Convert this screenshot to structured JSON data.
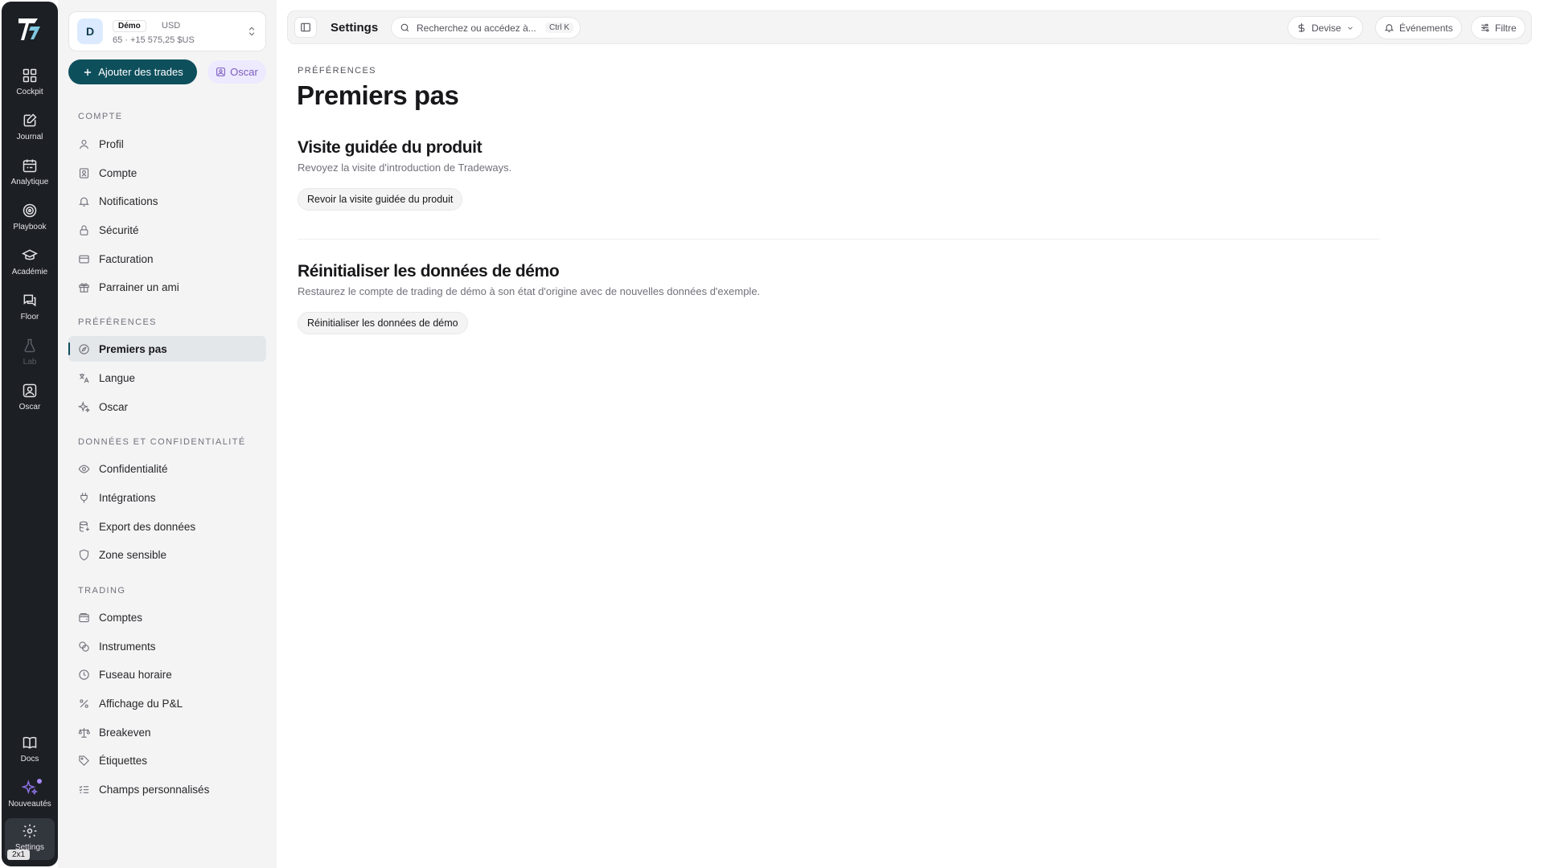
{
  "rail": {
    "items": [
      {
        "label": "Cockpit",
        "icon": "grid-icon"
      },
      {
        "label": "Journal",
        "icon": "edit-note-icon"
      },
      {
        "label": "Analytique",
        "icon": "calendar-chart-icon"
      },
      {
        "label": "Playbook",
        "icon": "target-icon"
      },
      {
        "label": "Académie",
        "icon": "graduation-cap-icon"
      },
      {
        "label": "Floor",
        "icon": "chat-bubbles-icon"
      },
      {
        "label": "Lab",
        "icon": "flask-icon"
      },
      {
        "label": "Oscar",
        "icon": "assistant-portrait-icon"
      }
    ],
    "bottom": [
      {
        "label": "Docs",
        "icon": "book-icon"
      },
      {
        "label": "Nouveautés",
        "icon": "sparkles-icon"
      },
      {
        "label": "Settings",
        "icon": "gear-icon"
      }
    ],
    "zoom": "2x1"
  },
  "account": {
    "avatar": "D",
    "tag": "Démo",
    "currency": "USD",
    "balance": "65 · +15 575,25 $US"
  },
  "actions": {
    "add_trades": "Ajouter des trades",
    "oscar": "Oscar"
  },
  "sidebar": {
    "sections": [
      {
        "title": "COMPTE",
        "items": [
          "Profil",
          "Compte",
          "Notifications",
          "Sécurité",
          "Facturation",
          "Parrainer un ami"
        ]
      },
      {
        "title": "PRÉFÉRENCES",
        "items": [
          "Premiers pas",
          "Langue",
          "Oscar"
        ]
      },
      {
        "title": "DONNÉES ET CONFIDENTIALITÉ",
        "items": [
          "Confidentialité",
          "Intégrations",
          "Export des données",
          "Zone sensible"
        ]
      },
      {
        "title": "TRADING",
        "items": [
          "Comptes",
          "Instruments",
          "Fuseau horaire",
          "Affichage du P&L",
          "Breakeven",
          "Étiquettes",
          "Champs personnalisés"
        ]
      }
    ],
    "active": "Premiers pas"
  },
  "topbar": {
    "title": "Settings",
    "search_placeholder": "Recherchez ou accédez à...",
    "shortcut": "Ctrl K",
    "currency": "Devise",
    "events": "Événements",
    "filter": "Filtre"
  },
  "main": {
    "breadcrumb": "PRÉFÉRENCES",
    "title": "Premiers pas",
    "tour": {
      "heading": "Visite guidée du produit",
      "description": "Revoyez la visite d'introduction de Tradeways.",
      "button": "Revoir la visite guidée du produit"
    },
    "reset": {
      "heading": "Réinitialiser les données de démo",
      "description": "Restaurez le compte de trading de démo à son état d'origine avec de nouvelles données d'exemple.",
      "button": "Réinitialiser les données de démo"
    }
  },
  "colors": {
    "rail_bg": "#1c1f24",
    "accent": "#0e4f5c",
    "oscar_accent": "#7c5cbf"
  }
}
